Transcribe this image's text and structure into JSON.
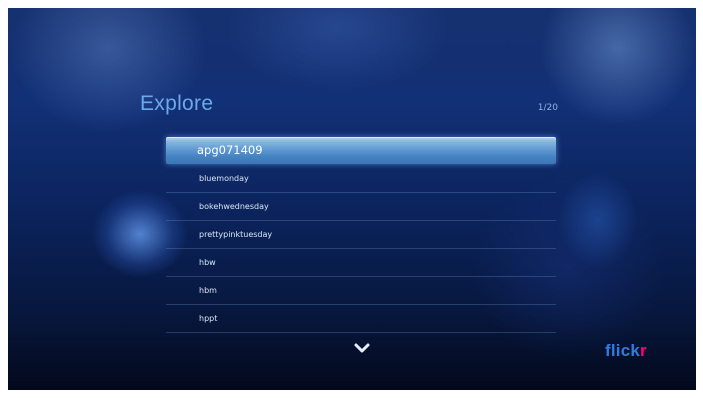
{
  "header": {
    "title": "Explore",
    "page_counter": "1/20"
  },
  "list": {
    "items": [
      {
        "label": "apg071409",
        "selected": true
      },
      {
        "label": "bluemonday",
        "selected": false
      },
      {
        "label": "bokehwednesday",
        "selected": false
      },
      {
        "label": "prettypinktuesday",
        "selected": false
      },
      {
        "label": "hbw",
        "selected": false
      },
      {
        "label": "hbm",
        "selected": false
      },
      {
        "label": "hppt",
        "selected": false
      }
    ]
  },
  "navigation": {
    "scroll_icon": "chevron-down-icon"
  },
  "branding": {
    "logo_main": "flick",
    "logo_accent": "r",
    "logo_main_color": "#2f7be0",
    "logo_accent_color": "#ff0084"
  },
  "colors": {
    "title": "#6aa9ea",
    "highlight": "#5d98cf",
    "background": "#0c2560"
  }
}
